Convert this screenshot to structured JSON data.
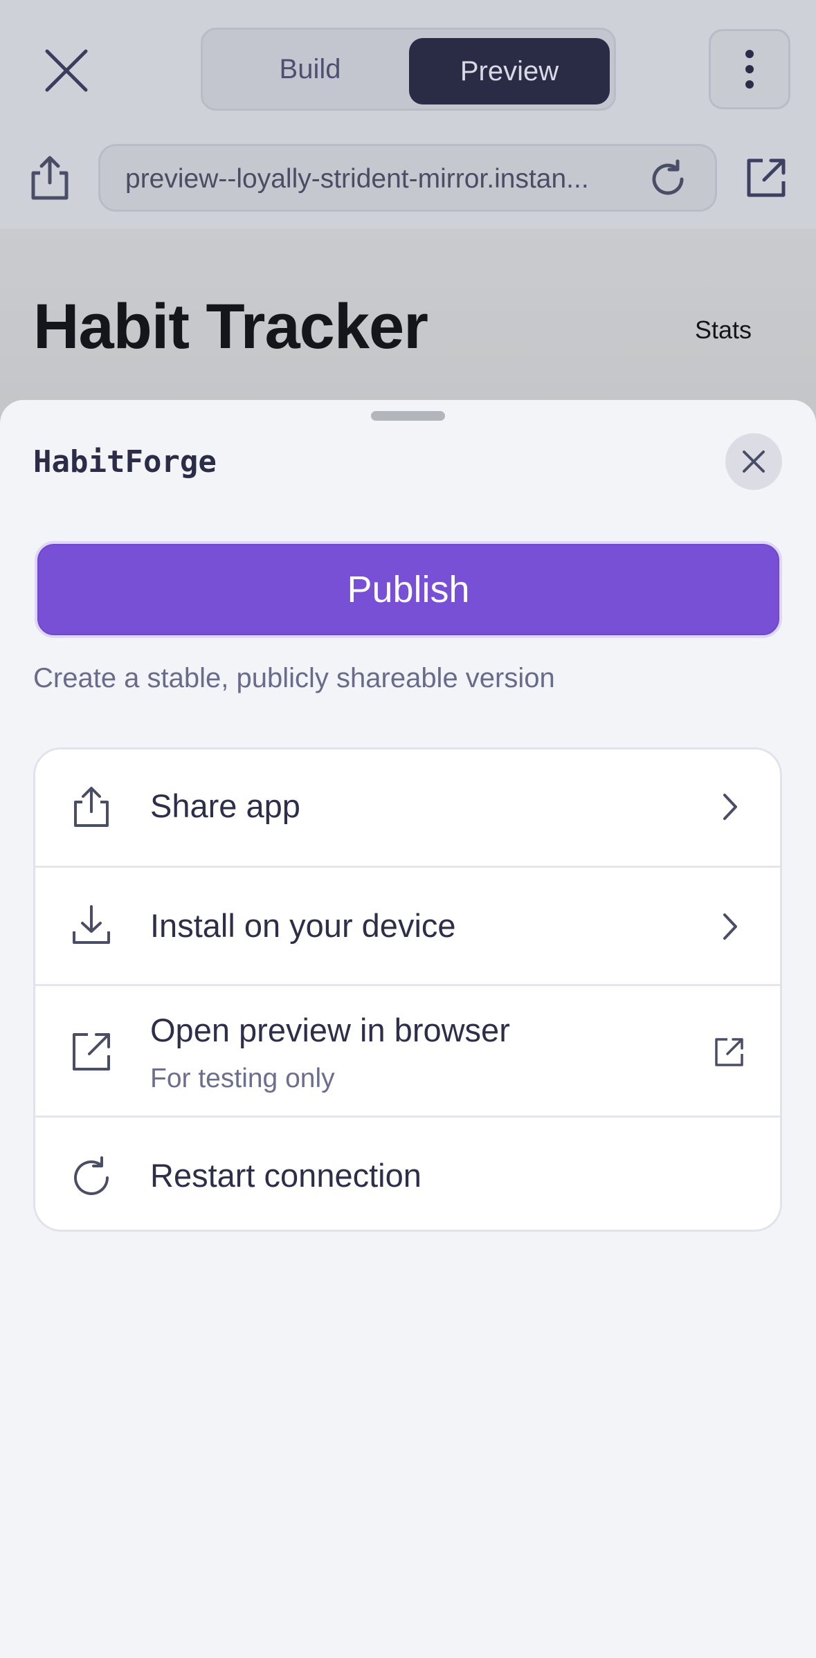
{
  "topbar": {
    "close_icon": "close-icon",
    "tabs": [
      {
        "label": "Build",
        "active": false
      },
      {
        "label": "Preview",
        "active": true
      }
    ],
    "more_icon": "more-vertical-icon",
    "share_icon": "share-icon",
    "url": "preview--loyally-strident-mirror.instan...",
    "reload_icon": "reload-icon",
    "open_external_icon": "external-link-icon"
  },
  "app": {
    "title": "Habit Tracker",
    "stats_label": "Stats"
  },
  "sheet": {
    "title": "HabitForge",
    "close_icon": "close-icon",
    "publish_label": "Publish",
    "publish_subtitle": "Create a stable, publicly shareable version",
    "items": [
      {
        "label": "Share app",
        "icon": "share-icon",
        "trailing": "chevron-right-icon"
      },
      {
        "label": "Install on your device",
        "icon": "download-icon",
        "trailing": "chevron-right-icon"
      },
      {
        "label": "Open preview in browser",
        "sublabel": "For testing only",
        "icon": "external-link-icon",
        "trailing": "external-link-icon"
      },
      {
        "label": "Restart connection",
        "icon": "reload-icon"
      }
    ]
  },
  "colors": {
    "accent": "#7750d6",
    "active_tab": "#2a2b45",
    "text_primary": "#2c2e4a",
    "text_secondary": "#6b6e8d"
  }
}
